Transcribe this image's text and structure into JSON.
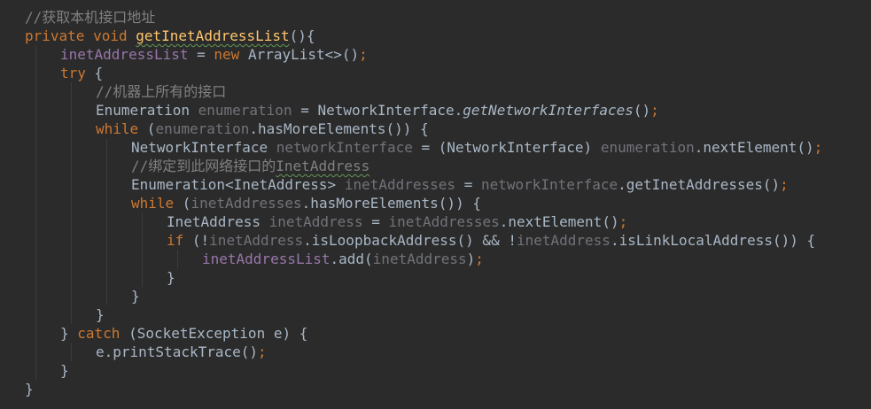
{
  "editor": {
    "theme_colors": {
      "background": "#2b2b2b",
      "comment": "#808080",
      "keyword": "#cc7832",
      "method_decl": "#ffc66d",
      "field": "#9876aa",
      "plain": "#a9b7c6",
      "unused_var": "#72737a",
      "typo_squiggle": "#629755"
    },
    "lines": [
      {
        "indent": 0,
        "tokens": [
          {
            "t": "//获取本机接口地址",
            "c": "comment"
          }
        ]
      },
      {
        "indent": 0,
        "tokens": [
          {
            "t": "private",
            "c": "keyword"
          },
          {
            "t": " ",
            "c": "plain"
          },
          {
            "t": "void",
            "c": "keyword"
          },
          {
            "t": " ",
            "c": "plain"
          },
          {
            "t": "getInetAddressList",
            "c": "method",
            "sq": true
          },
          {
            "t": "(){",
            "c": "punct"
          }
        ]
      },
      {
        "indent": 1,
        "tokens": [
          {
            "t": "inetAddressList",
            "c": "field"
          },
          {
            "t": " = ",
            "c": "plain"
          },
          {
            "t": "new",
            "c": "keyword"
          },
          {
            "t": " ArrayList<>()",
            "c": "plain"
          },
          {
            "t": ";",
            "c": "semi"
          }
        ]
      },
      {
        "indent": 1,
        "tokens": [
          {
            "t": "try",
            "c": "keyword"
          },
          {
            "t": " {",
            "c": "punct"
          }
        ]
      },
      {
        "indent": 2,
        "tokens": [
          {
            "t": "//机器上所有的接口",
            "c": "comment"
          }
        ]
      },
      {
        "indent": 2,
        "tokens": [
          {
            "t": "Enumeration",
            "c": "plain"
          },
          {
            "t": " ",
            "c": "plain"
          },
          {
            "t": "enumeration",
            "c": "unused"
          },
          {
            "t": " = NetworkInterface.",
            "c": "plain"
          },
          {
            "t": "getNetworkInterfaces",
            "c": "static"
          },
          {
            "t": "()",
            "c": "plain"
          },
          {
            "t": ";",
            "c": "semi"
          }
        ]
      },
      {
        "indent": 2,
        "tokens": [
          {
            "t": "while",
            "c": "keyword"
          },
          {
            "t": " (",
            "c": "plain"
          },
          {
            "t": "enumeration",
            "c": "unused"
          },
          {
            "t": ".hasMoreElements()) {",
            "c": "plain"
          }
        ]
      },
      {
        "indent": 3,
        "tokens": [
          {
            "t": "NetworkInterface",
            "c": "plain"
          },
          {
            "t": " ",
            "c": "plain"
          },
          {
            "t": "networkInterface",
            "c": "unused"
          },
          {
            "t": " = (NetworkInterface) ",
            "c": "plain"
          },
          {
            "t": "enumeration",
            "c": "unused"
          },
          {
            "t": ".nextElement()",
            "c": "plain"
          },
          {
            "t": ";",
            "c": "semi"
          }
        ]
      },
      {
        "indent": 3,
        "tokens": [
          {
            "t": "//绑定到此网络接口的",
            "c": "comment"
          },
          {
            "t": "InetAddress",
            "c": "comment",
            "sq": true
          }
        ]
      },
      {
        "indent": 3,
        "tokens": [
          {
            "t": "Enumeration<InetAddress> ",
            "c": "plain"
          },
          {
            "t": "inetAddresses",
            "c": "unused"
          },
          {
            "t": " = ",
            "c": "plain"
          },
          {
            "t": "networkInterface",
            "c": "unused"
          },
          {
            "t": ".getInetAddresses()",
            "c": "plain"
          },
          {
            "t": ";",
            "c": "semi"
          }
        ]
      },
      {
        "indent": 3,
        "tokens": [
          {
            "t": "while",
            "c": "keyword"
          },
          {
            "t": " (",
            "c": "plain"
          },
          {
            "t": "inetAddresses",
            "c": "unused"
          },
          {
            "t": ".hasMoreElements()) {",
            "c": "plain"
          }
        ]
      },
      {
        "indent": 4,
        "tokens": [
          {
            "t": "InetAddress",
            "c": "plain"
          },
          {
            "t": " ",
            "c": "plain"
          },
          {
            "t": "inetAddress",
            "c": "unused"
          },
          {
            "t": " = ",
            "c": "plain"
          },
          {
            "t": "inetAddresses",
            "c": "unused"
          },
          {
            "t": ".nextElement()",
            "c": "plain"
          },
          {
            "t": ";",
            "c": "semi"
          }
        ]
      },
      {
        "indent": 4,
        "tokens": [
          {
            "t": "if",
            "c": "keyword"
          },
          {
            "t": " (!",
            "c": "plain"
          },
          {
            "t": "inetAddress",
            "c": "unused"
          },
          {
            "t": ".isLoopbackAddress() && !",
            "c": "plain"
          },
          {
            "t": "inetAddress",
            "c": "unused"
          },
          {
            "t": ".isLinkLocalAddress()) {",
            "c": "plain"
          }
        ]
      },
      {
        "indent": 5,
        "tokens": [
          {
            "t": "inetAddressList",
            "c": "field"
          },
          {
            "t": ".add(",
            "c": "plain"
          },
          {
            "t": "inetAddress",
            "c": "unused"
          },
          {
            "t": ")",
            "c": "plain"
          },
          {
            "t": ";",
            "c": "semi"
          }
        ]
      },
      {
        "indent": 4,
        "tokens": [
          {
            "t": "}",
            "c": "punct"
          }
        ]
      },
      {
        "indent": 3,
        "tokens": [
          {
            "t": "}",
            "c": "punct"
          }
        ]
      },
      {
        "indent": 2,
        "tokens": [
          {
            "t": "}",
            "c": "punct"
          }
        ]
      },
      {
        "indent": 1,
        "tokens": [
          {
            "t": "} ",
            "c": "punct"
          },
          {
            "t": "catch",
            "c": "keyword"
          },
          {
            "t": " (SocketException e) {",
            "c": "plain"
          }
        ]
      },
      {
        "indent": 2,
        "tokens": [
          {
            "t": "e.printStackTrace()",
            "c": "plain"
          },
          {
            "t": ";",
            "c": "semi"
          }
        ]
      },
      {
        "indent": 1,
        "tokens": [
          {
            "t": "}",
            "c": "punct"
          }
        ]
      },
      {
        "indent": 0,
        "tokens": [
          {
            "t": "}",
            "c": "punct"
          }
        ]
      }
    ]
  }
}
